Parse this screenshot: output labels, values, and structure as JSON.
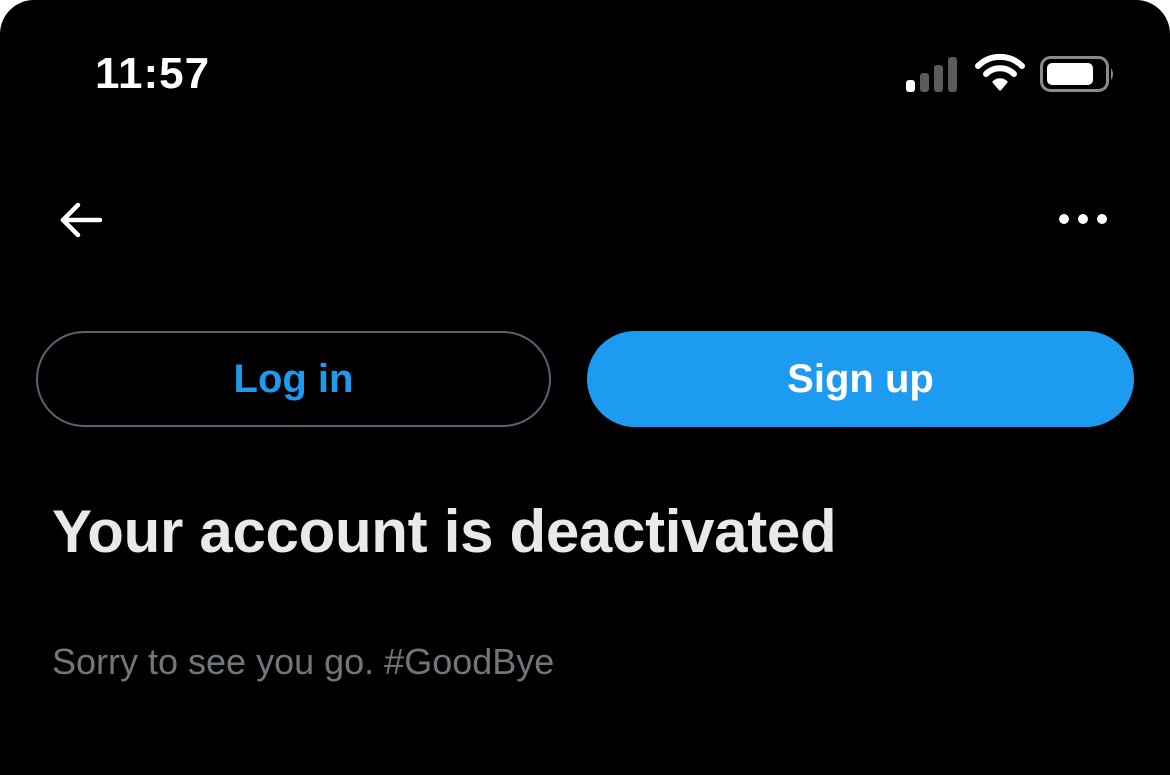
{
  "status_bar": {
    "time": "11:57",
    "signal_icon": "cellular-signal-icon",
    "wifi_icon": "wifi-icon",
    "battery_icon": "battery-icon",
    "signal_bars_active": 1,
    "signal_bars_total": 4
  },
  "nav": {
    "back_icon": "arrow-left-icon",
    "more_icon": "ellipsis-horizontal-icon"
  },
  "auth": {
    "login_label": "Log in",
    "signup_label": "Sign up"
  },
  "message": {
    "title": "Your account is deactivated",
    "body": "Sorry to see you go. #GoodBye"
  },
  "colors": {
    "background": "#000000",
    "accent": "#1d9bf0",
    "title_text": "#e7e9ea",
    "secondary_text": "#71767b",
    "outline": "#536471"
  }
}
